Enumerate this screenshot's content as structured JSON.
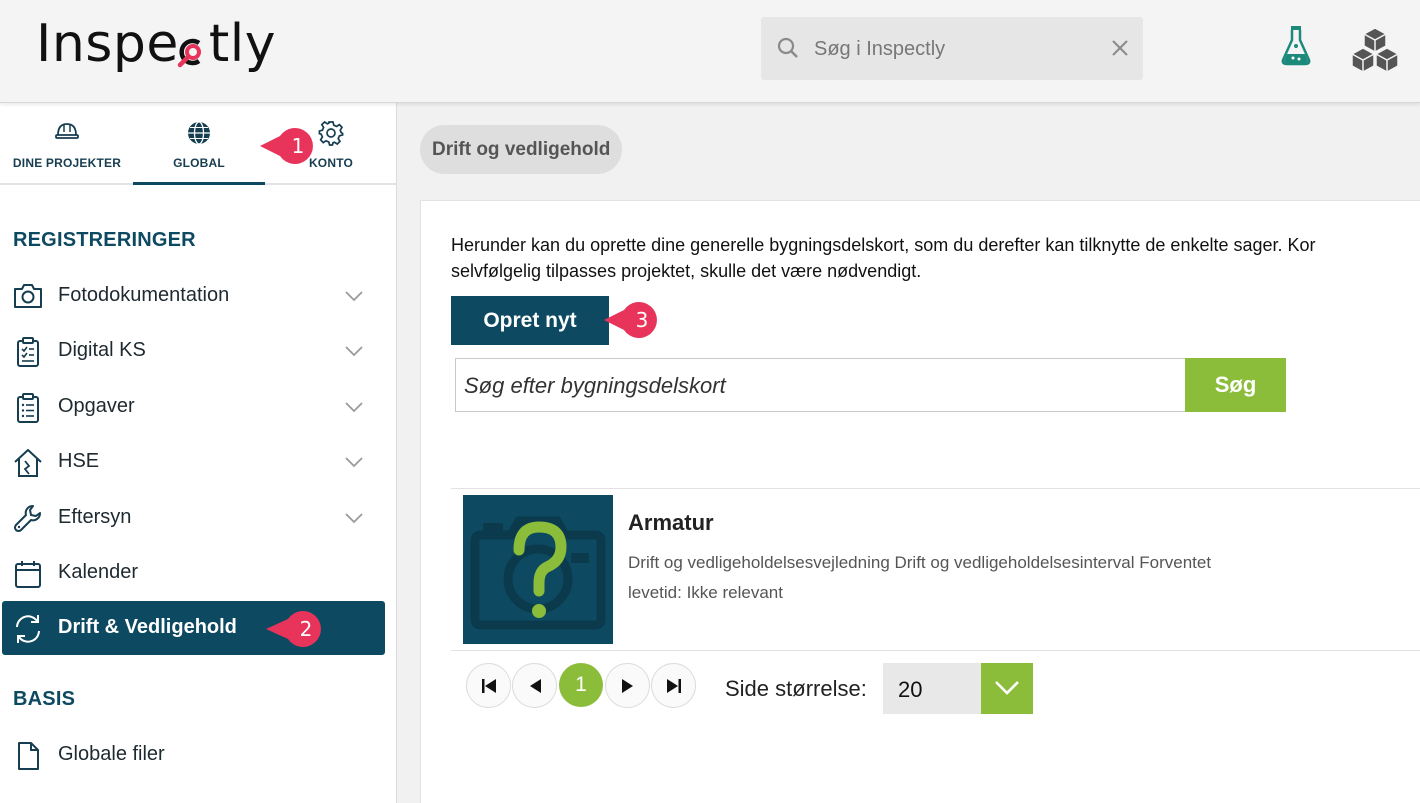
{
  "app": {
    "logo_text_left": "Inspe",
    "logo_text_right": "tly",
    "search_placeholder": "Søg i Inspectly",
    "colors": {
      "brand": "#0d4a61",
      "accent_green": "#8bbd3b",
      "logo_pink": "#e8345b",
      "callout": "#e8345b"
    }
  },
  "header_icons": [
    "flask-icon",
    "cubes-icon"
  ],
  "sidebar": {
    "tabs": [
      {
        "label": "DINE PROJEKTER",
        "icon": "helmet-icon"
      },
      {
        "label": "GLOBAL",
        "icon": "globe-icon",
        "active": true
      },
      {
        "label": "KONTO",
        "icon": "gear-icon"
      }
    ],
    "section_registreringer": "REGISTRERINGER",
    "items": [
      {
        "label": "Fotodokumentation",
        "icon": "camera-icon"
      },
      {
        "label": "Digital KS",
        "icon": "checklist-icon"
      },
      {
        "label": "Opgaver",
        "icon": "clipboard-icon"
      },
      {
        "label": "HSE",
        "icon": "house-icon"
      },
      {
        "label": "Eftersyn",
        "icon": "wrench-icon"
      },
      {
        "label": "Kalender",
        "icon": "calendar-icon"
      },
      {
        "label": "Drift & Vedligehold",
        "icon": "refresh-icon",
        "active": true
      }
    ],
    "section_basis": "BASIS",
    "basis_items": [
      {
        "label": "Globale filer",
        "icon": "file-icon"
      }
    ]
  },
  "main": {
    "breadcrumb": "Drift og vedligehold",
    "intro_line1": "Herunder kan du oprette dine generelle bygningsdelskort, som du derefter kan tilknytte de enkelte sager. Kor",
    "intro_line2": "selvfølgelig tilpasses projektet, skulle det være nødvendigt.",
    "create_button": "Opret nyt",
    "search_placeholder": "Søg efter bygningsdelskort",
    "search_button": "Søg",
    "items": [
      {
        "title": "Armatur",
        "desc_line1": "Drift og vedligeholdelsesvejledning Drift og vedligeholdelsesinterval Forventet",
        "desc_line2": "levetid: Ikke relevant"
      }
    ],
    "pagination": {
      "current_page": "1",
      "page_size_label": "Side størrelse:",
      "page_size_value": "20"
    }
  },
  "callouts": [
    "1",
    "2",
    "3"
  ]
}
